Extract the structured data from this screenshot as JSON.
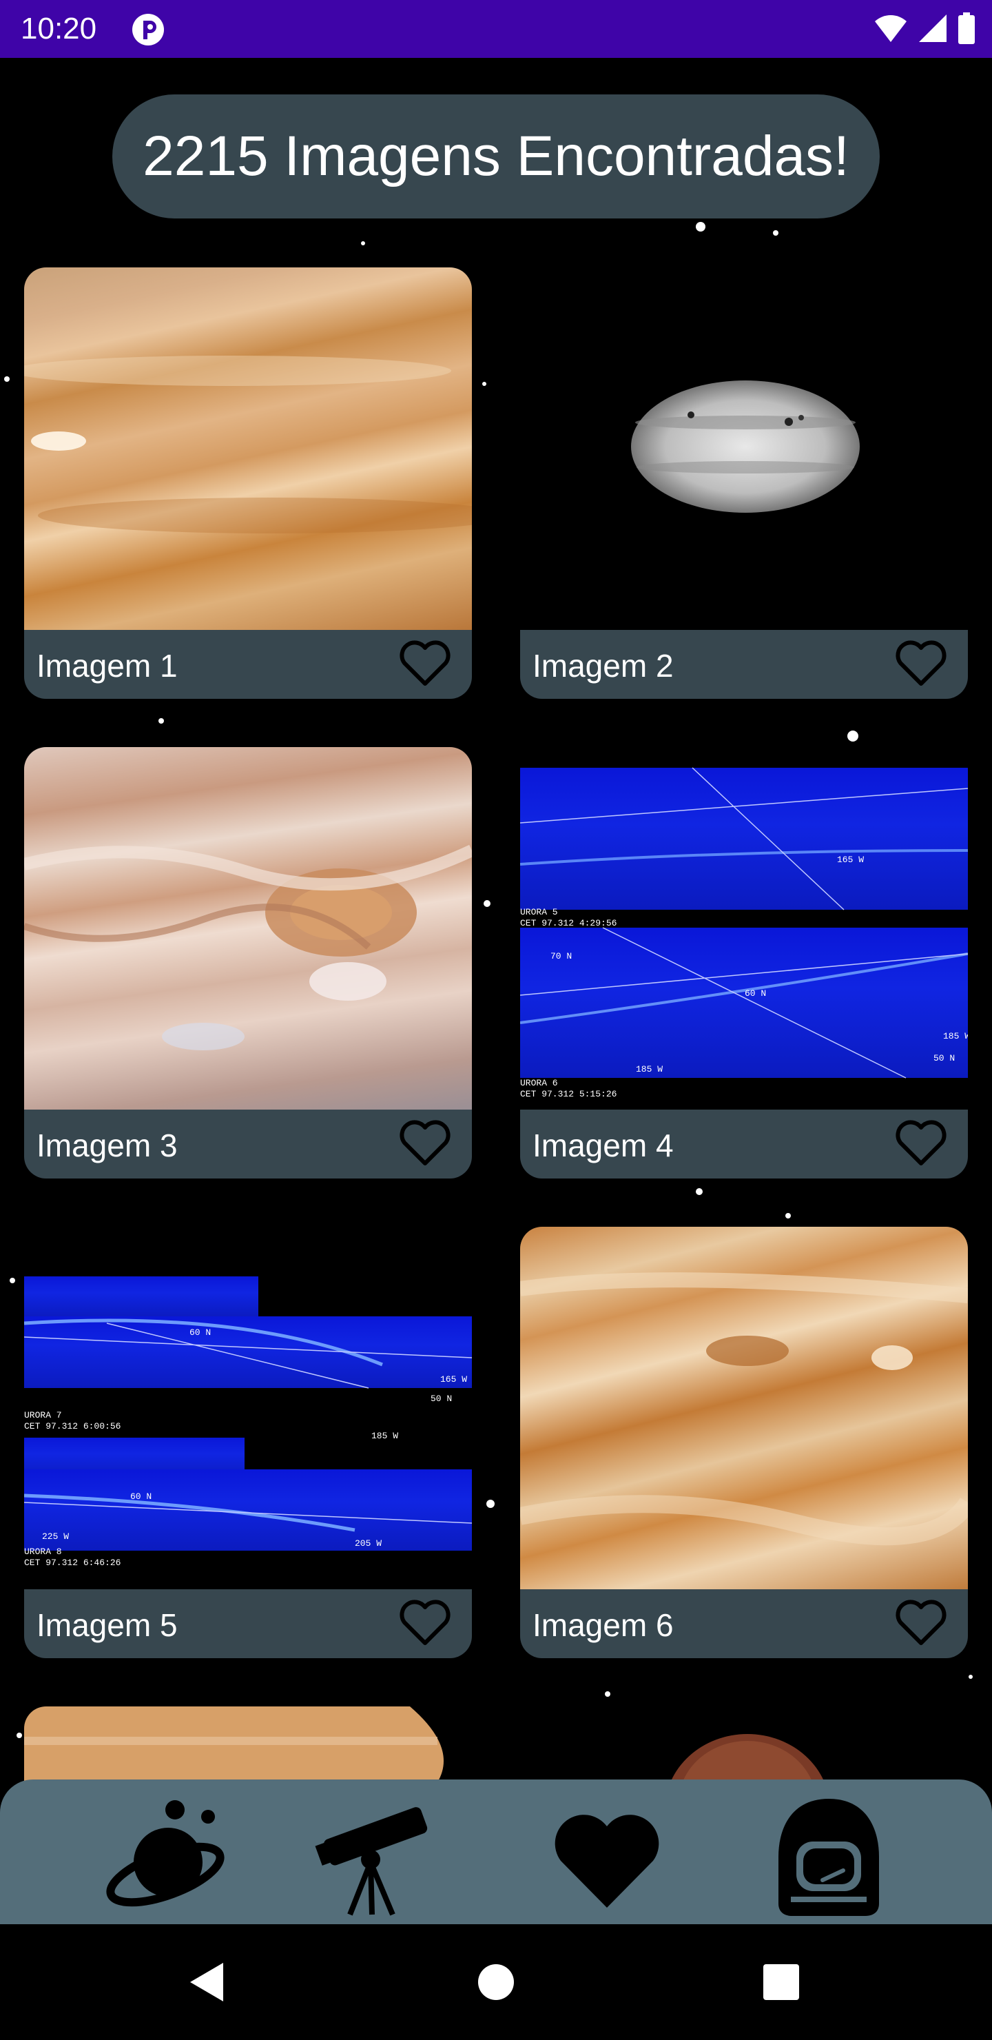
{
  "status_bar": {
    "time": "10:20",
    "background": "#3f04a8",
    "icons": [
      "app-notification-icon",
      "wifi-icon",
      "signal-icon",
      "battery-icon"
    ]
  },
  "header": {
    "results_text": "2215 Imagens Encontradas!"
  },
  "gallery": {
    "cards": [
      {
        "label": "Imagem 1",
        "favorite": false,
        "thumb": "jupiter-bands"
      },
      {
        "label": "Imagem 2",
        "favorite": false,
        "thumb": "jupiter-grayscale"
      },
      {
        "label": "Imagem 3",
        "favorite": false,
        "thumb": "jupiter-great-red-spot"
      },
      {
        "label": "Imagem 4",
        "favorite": false,
        "thumb": "aurora-ultraviolet"
      },
      {
        "label": "Imagem 5",
        "favorite": false,
        "thumb": "aurora-ultraviolet"
      },
      {
        "label": "Imagem 6",
        "favorite": false,
        "thumb": "jupiter-bands"
      }
    ],
    "aurora4": {
      "tag_a": "URORA 5",
      "time_a": "CET 97.312 4:29:56",
      "tag_b": "URORA 6",
      "time_b": "CET 97.312 5:15:26",
      "labels": [
        "165 W",
        "70 N",
        "60 N",
        "185 W",
        "50 N",
        "185 W"
      ]
    },
    "aurora5": {
      "tag_a": "URORA 7",
      "time_a": "CET 97.312 6:00:56",
      "tag_b": "URORA 8",
      "time_b": "CET 97.312 6:46:26",
      "labels": [
        "60 N",
        "165 W",
        "50 N",
        "185 W",
        "60 N",
        "225 W",
        "205 W"
      ]
    }
  },
  "bottom_nav": {
    "items": [
      "planet-icon",
      "telescope-icon",
      "heart-icon",
      "astronaut-helmet-icon"
    ],
    "background": "#546e7a"
  },
  "system_nav": {
    "buttons": [
      "back-icon",
      "home-icon",
      "recents-icon"
    ]
  },
  "colors": {
    "card_footer": "#37474f",
    "pill": "#37474f"
  }
}
